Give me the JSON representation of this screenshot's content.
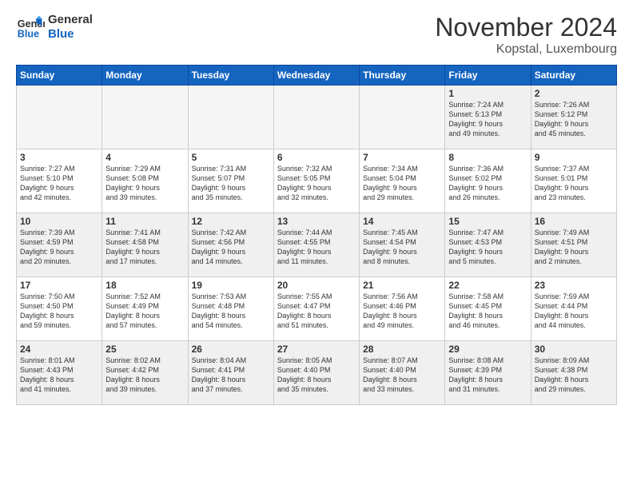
{
  "logo": {
    "line1": "General",
    "line2": "Blue"
  },
  "title": "November 2024",
  "location": "Kopstal, Luxembourg",
  "days": [
    "Sunday",
    "Monday",
    "Tuesday",
    "Wednesday",
    "Thursday",
    "Friday",
    "Saturday"
  ],
  "weeks": [
    [
      {
        "num": "",
        "info": "",
        "empty": true
      },
      {
        "num": "",
        "info": "",
        "empty": true
      },
      {
        "num": "",
        "info": "",
        "empty": true
      },
      {
        "num": "",
        "info": "",
        "empty": true
      },
      {
        "num": "",
        "info": "",
        "empty": true
      },
      {
        "num": "1",
        "info": "Sunrise: 7:24 AM\nSunset: 5:13 PM\nDaylight: 9 hours\nand 49 minutes."
      },
      {
        "num": "2",
        "info": "Sunrise: 7:26 AM\nSunset: 5:12 PM\nDaylight: 9 hours\nand 45 minutes."
      }
    ],
    [
      {
        "num": "3",
        "info": "Sunrise: 7:27 AM\nSunset: 5:10 PM\nDaylight: 9 hours\nand 42 minutes."
      },
      {
        "num": "4",
        "info": "Sunrise: 7:29 AM\nSunset: 5:08 PM\nDaylight: 9 hours\nand 39 minutes."
      },
      {
        "num": "5",
        "info": "Sunrise: 7:31 AM\nSunset: 5:07 PM\nDaylight: 9 hours\nand 35 minutes."
      },
      {
        "num": "6",
        "info": "Sunrise: 7:32 AM\nSunset: 5:05 PM\nDaylight: 9 hours\nand 32 minutes."
      },
      {
        "num": "7",
        "info": "Sunrise: 7:34 AM\nSunset: 5:04 PM\nDaylight: 9 hours\nand 29 minutes."
      },
      {
        "num": "8",
        "info": "Sunrise: 7:36 AM\nSunset: 5:02 PM\nDaylight: 9 hours\nand 26 minutes."
      },
      {
        "num": "9",
        "info": "Sunrise: 7:37 AM\nSunset: 5:01 PM\nDaylight: 9 hours\nand 23 minutes."
      }
    ],
    [
      {
        "num": "10",
        "info": "Sunrise: 7:39 AM\nSunset: 4:59 PM\nDaylight: 9 hours\nand 20 minutes."
      },
      {
        "num": "11",
        "info": "Sunrise: 7:41 AM\nSunset: 4:58 PM\nDaylight: 9 hours\nand 17 minutes."
      },
      {
        "num": "12",
        "info": "Sunrise: 7:42 AM\nSunset: 4:56 PM\nDaylight: 9 hours\nand 14 minutes."
      },
      {
        "num": "13",
        "info": "Sunrise: 7:44 AM\nSunset: 4:55 PM\nDaylight: 9 hours\nand 11 minutes."
      },
      {
        "num": "14",
        "info": "Sunrise: 7:45 AM\nSunset: 4:54 PM\nDaylight: 9 hours\nand 8 minutes."
      },
      {
        "num": "15",
        "info": "Sunrise: 7:47 AM\nSunset: 4:53 PM\nDaylight: 9 hours\nand 5 minutes."
      },
      {
        "num": "16",
        "info": "Sunrise: 7:49 AM\nSunset: 4:51 PM\nDaylight: 9 hours\nand 2 minutes."
      }
    ],
    [
      {
        "num": "17",
        "info": "Sunrise: 7:50 AM\nSunset: 4:50 PM\nDaylight: 8 hours\nand 59 minutes."
      },
      {
        "num": "18",
        "info": "Sunrise: 7:52 AM\nSunset: 4:49 PM\nDaylight: 8 hours\nand 57 minutes."
      },
      {
        "num": "19",
        "info": "Sunrise: 7:53 AM\nSunset: 4:48 PM\nDaylight: 8 hours\nand 54 minutes."
      },
      {
        "num": "20",
        "info": "Sunrise: 7:55 AM\nSunset: 4:47 PM\nDaylight: 8 hours\nand 51 minutes."
      },
      {
        "num": "21",
        "info": "Sunrise: 7:56 AM\nSunset: 4:46 PM\nDaylight: 8 hours\nand 49 minutes."
      },
      {
        "num": "22",
        "info": "Sunrise: 7:58 AM\nSunset: 4:45 PM\nDaylight: 8 hours\nand 46 minutes."
      },
      {
        "num": "23",
        "info": "Sunrise: 7:59 AM\nSunset: 4:44 PM\nDaylight: 8 hours\nand 44 minutes."
      }
    ],
    [
      {
        "num": "24",
        "info": "Sunrise: 8:01 AM\nSunset: 4:43 PM\nDaylight: 8 hours\nand 41 minutes."
      },
      {
        "num": "25",
        "info": "Sunrise: 8:02 AM\nSunset: 4:42 PM\nDaylight: 8 hours\nand 39 minutes."
      },
      {
        "num": "26",
        "info": "Sunrise: 8:04 AM\nSunset: 4:41 PM\nDaylight: 8 hours\nand 37 minutes."
      },
      {
        "num": "27",
        "info": "Sunrise: 8:05 AM\nSunset: 4:40 PM\nDaylight: 8 hours\nand 35 minutes."
      },
      {
        "num": "28",
        "info": "Sunrise: 8:07 AM\nSunset: 4:40 PM\nDaylight: 8 hours\nand 33 minutes."
      },
      {
        "num": "29",
        "info": "Sunrise: 8:08 AM\nSunset: 4:39 PM\nDaylight: 8 hours\nand 31 minutes."
      },
      {
        "num": "30",
        "info": "Sunrise: 8:09 AM\nSunset: 4:38 PM\nDaylight: 8 hours\nand 29 minutes."
      }
    ]
  ]
}
